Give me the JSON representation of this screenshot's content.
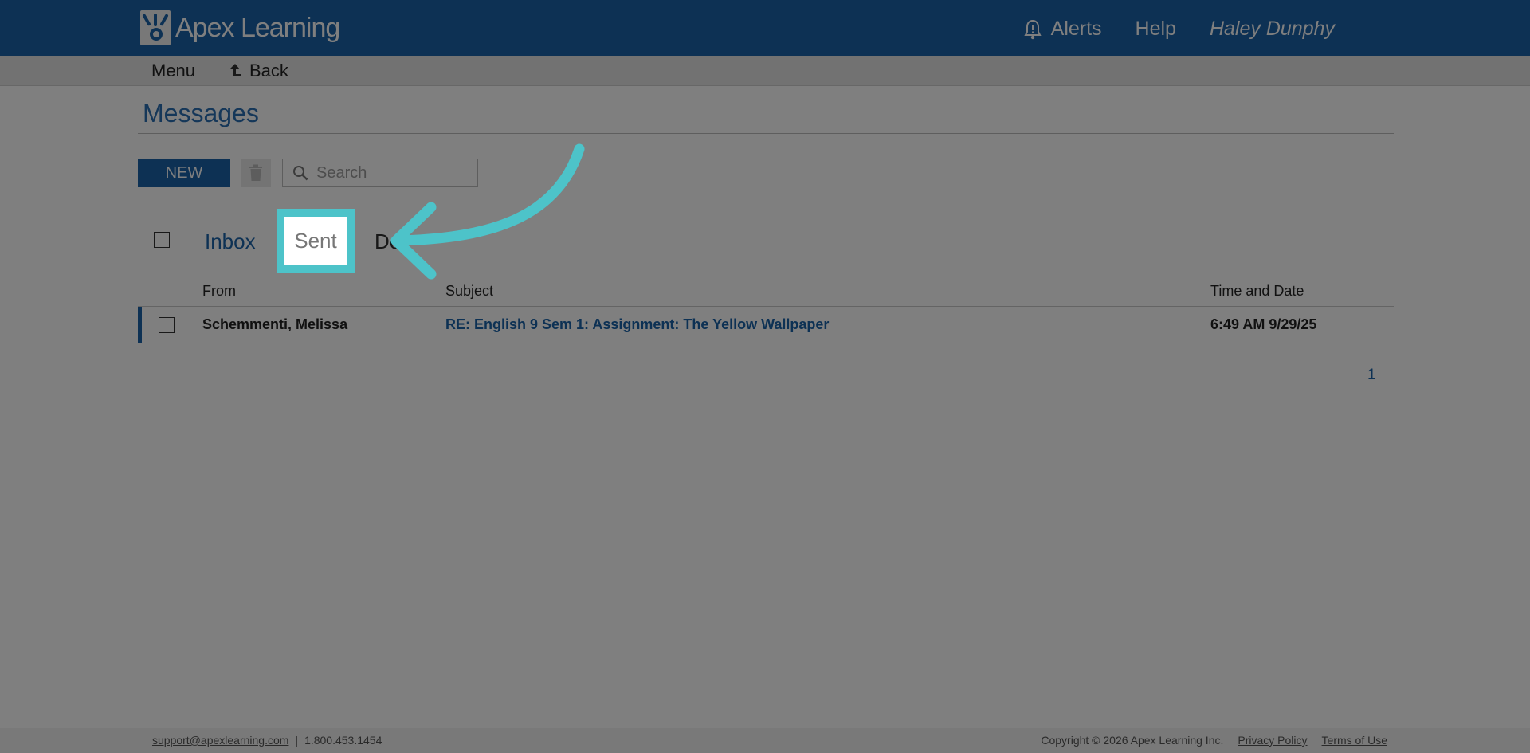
{
  "header": {
    "logo_text": "Apex Learning",
    "alerts": "Alerts",
    "help": "Help",
    "user": "Haley Dunphy"
  },
  "subnav": {
    "menu": "Menu",
    "back": "Back"
  },
  "page": {
    "title": "Messages"
  },
  "toolbar": {
    "new_label": "NEW",
    "search_placeholder": "Search"
  },
  "tabs": {
    "inbox": "Inbox",
    "sent": "Sent",
    "deleted": "De"
  },
  "table": {
    "columns": {
      "from": "From",
      "subject": "Subject",
      "date": "Time and Date"
    },
    "rows": [
      {
        "from": "Schemmenti, Melissa",
        "subject": "RE: English 9 Sem 1: Assignment: The Yellow Wallpaper",
        "date": "6:49 AM 9/29/25"
      }
    ]
  },
  "pagination": {
    "page": "1"
  },
  "footer": {
    "email": "support@apexlearning.com",
    "separator": "|",
    "phone": "1.800.453.1454",
    "copyright": "Copyright © 2026 Apex Learning Inc.",
    "privacy": "Privacy Policy",
    "terms": "Terms of Use"
  },
  "colors": {
    "brand_blue": "#1a63a8",
    "highlight_teal": "#4dc3c9"
  },
  "icons": {
    "bell": "bell-icon",
    "back": "back-arrow-icon",
    "trash": "trash-icon",
    "search": "search-icon",
    "callout": "callout-arrow"
  }
}
